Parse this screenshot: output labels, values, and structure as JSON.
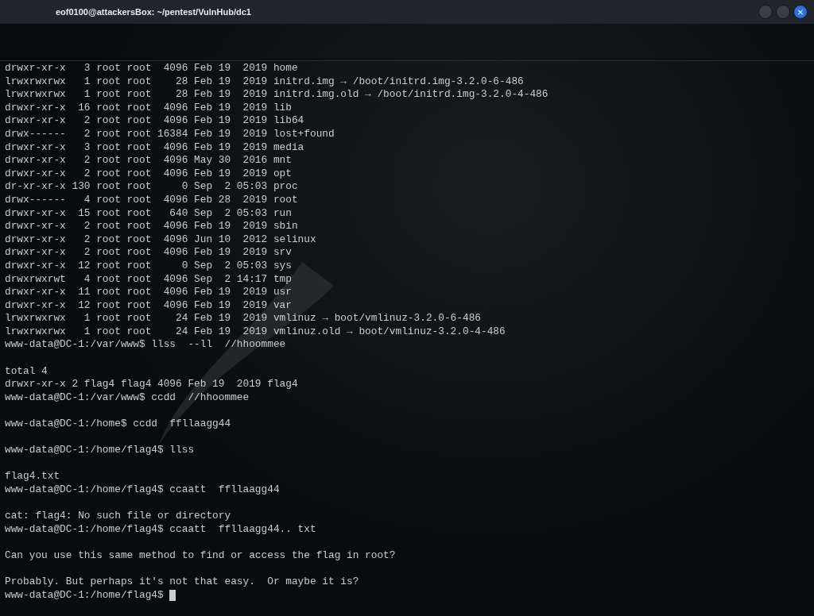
{
  "window": {
    "title": "eof0100@attackersBox: ~/pentest/VulnHub/dc1",
    "buttons": [
      {
        "kind": "minimize"
      },
      {
        "kind": "maximize"
      },
      {
        "kind": "close",
        "label": "✕"
      }
    ]
  },
  "terminal": {
    "cursor": true,
    "lines": [
      {
        "text": "drwxr-xr-x   3 root root  4096 Feb 19  2019 home",
        "space_before": false
      },
      {
        "text": "lrwxrwxrwx   1 root root    28 Feb 19  2019 initrd.img → /boot/initrd.img-3.2.0-6-486",
        "space_before": false
      },
      {
        "text": "lrwxrwxrwx   1 root root    28 Feb 19  2019 initrd.img.old → /boot/initrd.img-3.2.0-4-486",
        "space_before": false
      },
      {
        "text": "drwxr-xr-x  16 root root  4096 Feb 19  2019 lib",
        "space_before": false
      },
      {
        "text": "drwxr-xr-x   2 root root  4096 Feb 19  2019 lib64",
        "space_before": false
      },
      {
        "text": "drwx------   2 root root 16384 Feb 19  2019 lost+found",
        "space_before": false
      },
      {
        "text": "drwxr-xr-x   3 root root  4096 Feb 19  2019 media",
        "space_before": false
      },
      {
        "text": "drwxr-xr-x   2 root root  4096 May 30  2016 mnt",
        "space_before": false
      },
      {
        "text": "drwxr-xr-x   2 root root  4096 Feb 19  2019 opt",
        "space_before": false
      },
      {
        "text": "dr-xr-xr-x 130 root root     0 Sep  2 05:03 proc",
        "space_before": false
      },
      {
        "text": "drwx------   4 root root  4096 Feb 28  2019 root",
        "space_before": false
      },
      {
        "text": "drwxr-xr-x  15 root root   640 Sep  2 05:03 run",
        "space_before": false
      },
      {
        "text": "drwxr-xr-x   2 root root  4096 Feb 19  2019 sbin",
        "space_before": false
      },
      {
        "text": "drwxr-xr-x   2 root root  4096 Jun 10  2012 selinux",
        "space_before": false
      },
      {
        "text": "drwxr-xr-x   2 root root  4096 Feb 19  2019 srv",
        "space_before": false
      },
      {
        "text": "drwxr-xr-x  12 root root     0 Sep  2 05:03 sys",
        "space_before": false
      },
      {
        "text": "drwxrwxrwt   4 root root  4096 Sep  2 14:17 tmp",
        "space_before": false
      },
      {
        "text": "drwxr-xr-x  11 root root  4096 Feb 19  2019 usr",
        "space_before": false
      },
      {
        "text": "drwxr-xr-x  12 root root  4096 Feb 19  2019 var",
        "space_before": false
      },
      {
        "text": "lrwxrwxrwx   1 root root    24 Feb 19  2019 vmlinuz → boot/vmlinuz-3.2.0-6-486",
        "space_before": false
      },
      {
        "text": "lrwxrwxrwx   1 root root    24 Feb 19  2019 vmlinuz.old → boot/vmlinuz-3.2.0-4-486",
        "space_before": false
      },
      {
        "text": "www-data@DC-1:/var/www$ llss  --ll  //hhoommee",
        "space_before": false
      },
      {
        "text": "total 4",
        "space_before": true
      },
      {
        "text": "drwxr-xr-x 2 flag4 flag4 4096 Feb 19  2019 flag4",
        "space_before": false
      },
      {
        "text": "www-data@DC-1:/var/www$ ccdd  //hhoommee",
        "space_before": false
      },
      {
        "text": "www-data@DC-1:/home$ ccdd  ffllaagg44",
        "space_before": true
      },
      {
        "text": "www-data@DC-1:/home/flag4$ llss",
        "space_before": true
      },
      {
        "text": "flag4.txt",
        "space_before": true
      },
      {
        "text": "www-data@DC-1:/home/flag4$ ccaatt  ffllaagg44",
        "space_before": false
      },
      {
        "text": "cat: flag4: No such file or directory",
        "space_before": true
      },
      {
        "text": "www-data@DC-1:/home/flag4$ ccaatt  ffllaagg44.. txt",
        "space_before": false
      },
      {
        "text": "Can you use this same method to find or access the flag in root?",
        "space_before": true
      },
      {
        "text": "Probably. But perhaps it's not that easy.  Or maybe it is?",
        "space_before": true
      },
      {
        "text": "www-data@DC-1:/home/flag4$",
        "space_before": false
      }
    ]
  }
}
